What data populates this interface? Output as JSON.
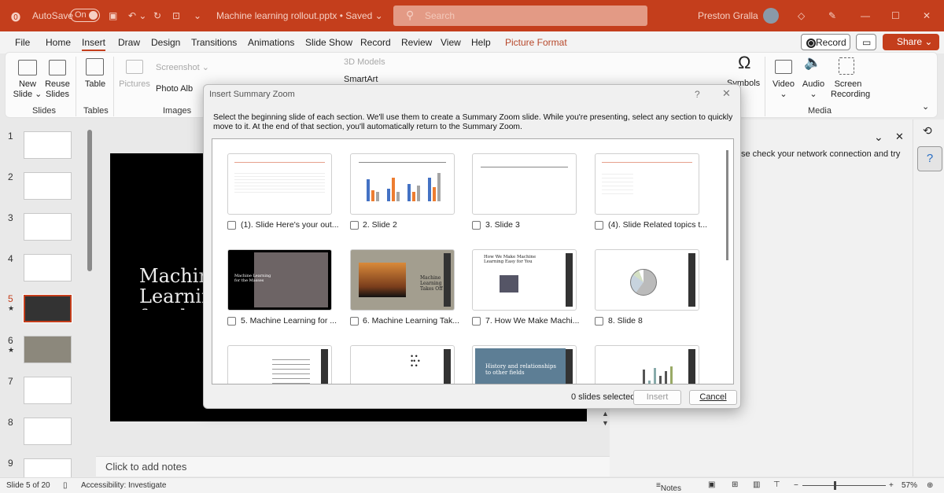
{
  "titlebar": {
    "autosave_label": "AutoSave",
    "autosave_state": "On",
    "document": "Machine learning rollout.pptx • Saved ⌄",
    "search_placeholder": "Search",
    "user": "Preston Gralla",
    "accent": "#c43e1c"
  },
  "tabs": [
    "File",
    "Home",
    "Insert",
    "Draw",
    "Design",
    "Transitions",
    "Animations",
    "Slide Show",
    "Record",
    "Review",
    "View",
    "Help",
    "Picture Format"
  ],
  "active_tab": "Insert",
  "actions": {
    "record": "Record",
    "share": "Share"
  },
  "ribbon": {
    "new_slide": "New Slide ⌄",
    "reuse_slides": "Reuse Slides",
    "table": "Table",
    "pictures": "Pictures",
    "screenshot": "Screenshot ⌄",
    "photo_album": "Photo Alb",
    "models": "3D Models",
    "smartart": "SmartArt",
    "symbols": "Symbols",
    "video": "Video",
    "audio": "Audio",
    "screen_recording": "Screen Recording",
    "groups": {
      "slides": "Slides",
      "tables": "Tables",
      "images": "Images",
      "media": "Media"
    }
  },
  "thumbnails": [
    {
      "n": "1"
    },
    {
      "n": "2"
    },
    {
      "n": "3"
    },
    {
      "n": "4"
    },
    {
      "n": "5",
      "star": "★"
    },
    {
      "n": "6",
      "star": "★"
    },
    {
      "n": "7"
    },
    {
      "n": "8"
    },
    {
      "n": "9"
    }
  ],
  "slide": {
    "title": "Machine Learning for the Masses"
  },
  "notes_placeholder": "Click to add notes",
  "rightpane": {
    "message": "se check your network connection and try"
  },
  "dialog": {
    "title": "Insert Summary Zoom",
    "help": "?",
    "description": "Select the beginning slide of each section. We'll use them to create a Summary Zoom slide. While you're presenting, select any section to quickly move to it. At the end of that section, you'll automatically return to the Summary Zoom.",
    "items": [
      "(1). Slide Here's your out...",
      "2. Slide 2",
      "3. Slide 3",
      "(4). Slide Related topics t...",
      "5. Machine Learning for ...",
      "6. Machine Learning Tak...",
      "7. How We Make Machi...",
      "8. Slide 8"
    ],
    "thumb_texts": {
      "t5": "Machine Learning for the Masses",
      "t6": "Machine Learning Takes Off",
      "t7": "How We Make Machine Learning Easy for You",
      "t11": "History and relationships to other fields"
    },
    "selected_count": "0 slides selected",
    "insert": "Insert",
    "cancel": "Cancel"
  },
  "status": {
    "slide": "Slide 5 of 20",
    "accessibility": "Accessibility: Investigate",
    "notes": "Notes",
    "zoom": "57%"
  }
}
